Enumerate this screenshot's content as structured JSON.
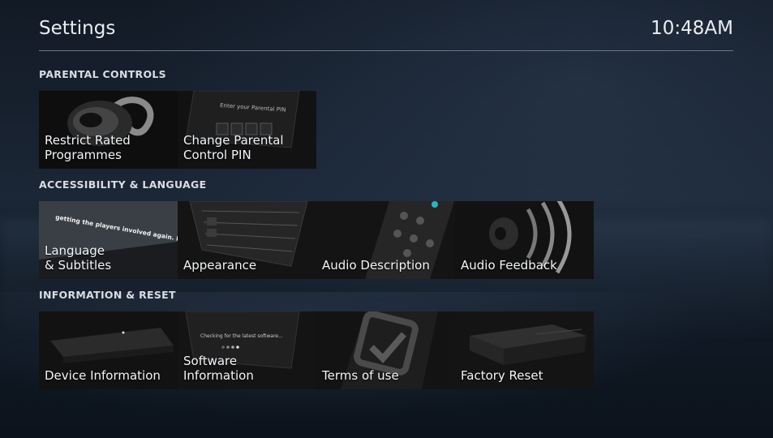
{
  "header": {
    "title": "Settings",
    "time": "10:48AM"
  },
  "sections": [
    {
      "title": "PARENTAL CONTROLS",
      "tiles": [
        {
          "label": "Restrict Rated\nProgrammes",
          "icon": "earpiece-icon"
        },
        {
          "label": "Change Parental\nControl PIN",
          "icon": "pin-screen-icon",
          "art_text": "Enter your Parental PIN"
        }
      ]
    },
    {
      "title": "ACCESSIBILITY & LANGUAGE",
      "tiles": [
        {
          "label": "Language\n& Subtitles",
          "icon": "subtitles-screen-icon",
          "art_text": "getting the players involved again. It is a really big team effort."
        },
        {
          "label": "Appearance",
          "icon": "tv-guide-icon"
        },
        {
          "label": "Audio Description",
          "icon": "remote-control-icon"
        },
        {
          "label": "Audio Feedback",
          "icon": "speaker-sound-icon"
        }
      ]
    },
    {
      "title": "INFORMATION & RESET",
      "tiles": [
        {
          "label": "Device Information",
          "icon": "set-top-box-icon",
          "selected": true
        },
        {
          "label": "Software\nInformation",
          "icon": "software-update-screen-icon",
          "art_text": "Checking for the latest software..."
        },
        {
          "label": "Terms of use",
          "icon": "checkmark-box-icon"
        },
        {
          "label": "Factory Reset",
          "icon": "set-top-box-reset-icon"
        }
      ]
    }
  ],
  "colors": {
    "selection": "#2f8fd8",
    "tile_bg": "#141414"
  }
}
